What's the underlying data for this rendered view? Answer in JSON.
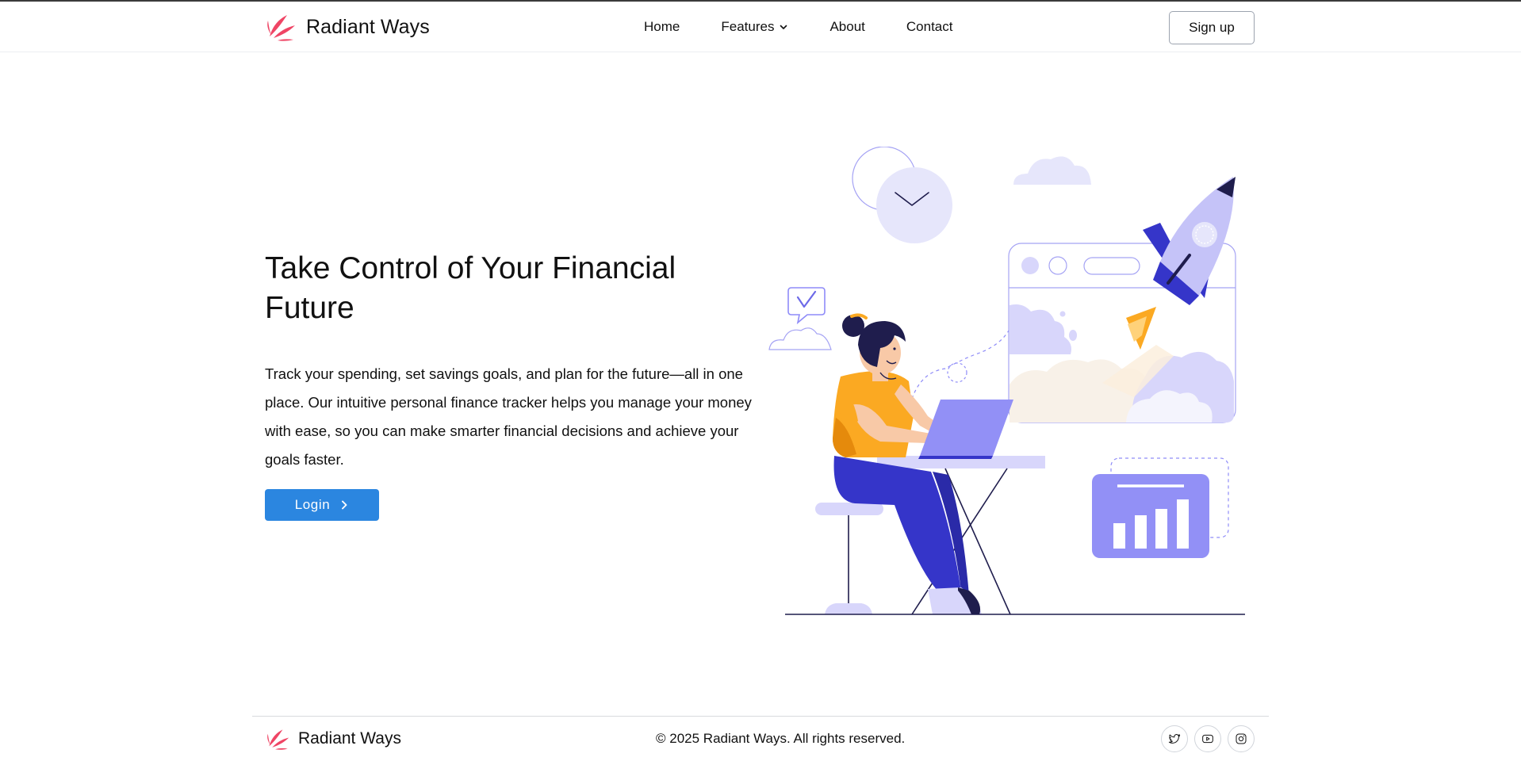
{
  "header": {
    "brand": "Radiant Ways",
    "nav": [
      {
        "label": "Home"
      },
      {
        "label": "Features",
        "has_dropdown": true
      },
      {
        "label": "About"
      },
      {
        "label": "Contact"
      }
    ],
    "signup_label": "Sign up"
  },
  "hero": {
    "title": "Take Control of Your Financial Future",
    "description": "Track your spending, set savings goals, and plan for the future—all in one place. Our intuitive personal finance tracker helps you manage your money with ease, so you can make smarter financial decisions and achieve your goals faster.",
    "login_label": "Login"
  },
  "footer": {
    "brand": "Radiant Ways",
    "copyright": "© 2025 Radiant Ways. All rights reserved.",
    "socials": [
      {
        "icon": "twitter-icon"
      },
      {
        "icon": "youtube-icon"
      },
      {
        "icon": "instagram-icon"
      }
    ]
  },
  "colors": {
    "primary": "#2b86e0",
    "logo": "#ef4565",
    "accent_purple": "#8f8cf8",
    "accent_blue": "#3535c9",
    "accent_orange": "#fba922"
  },
  "icons": {
    "logo": "leaf-sparkle-icon",
    "features_dropdown": "chevron-down-icon",
    "login_arrow": "chevron-right-icon"
  }
}
